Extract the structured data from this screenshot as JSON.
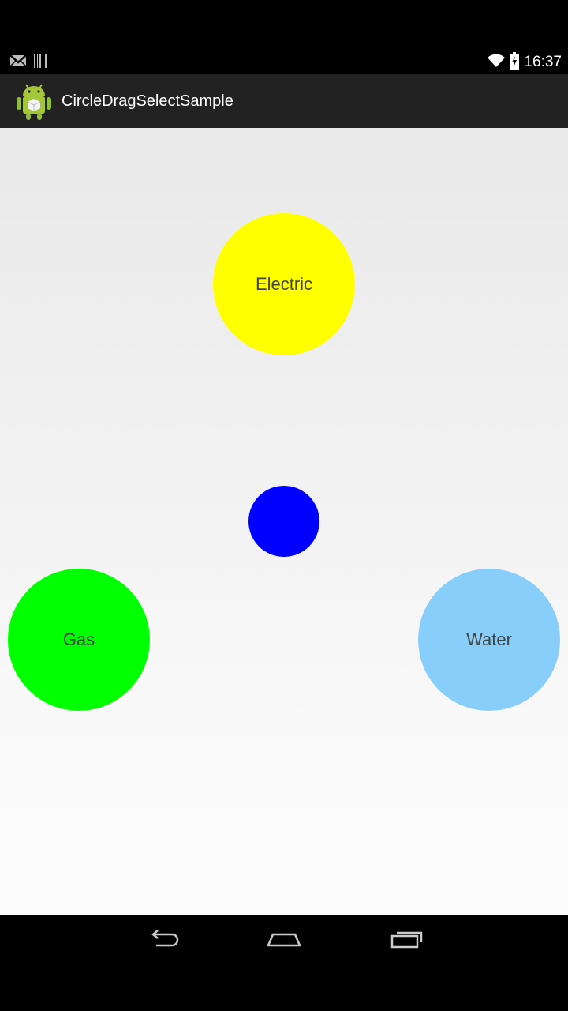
{
  "status_bar": {
    "time": "16:37",
    "icons": [
      "gmail-icon",
      "barcode-icon",
      "wifi-icon",
      "battery-icon"
    ]
  },
  "action_bar": {
    "title": "CircleDragSelectSample",
    "icon": "android-app-icon"
  },
  "circles": {
    "electric": {
      "label": "Electric",
      "color": "#ffff00"
    },
    "gas": {
      "label": "Gas",
      "color": "#00ff00"
    },
    "water": {
      "label": "Water",
      "color": "#87cefa"
    },
    "handle": {
      "color": "#0000ff"
    }
  },
  "nav_bar": {
    "buttons": [
      "back-icon",
      "home-icon",
      "recents-icon"
    ]
  }
}
